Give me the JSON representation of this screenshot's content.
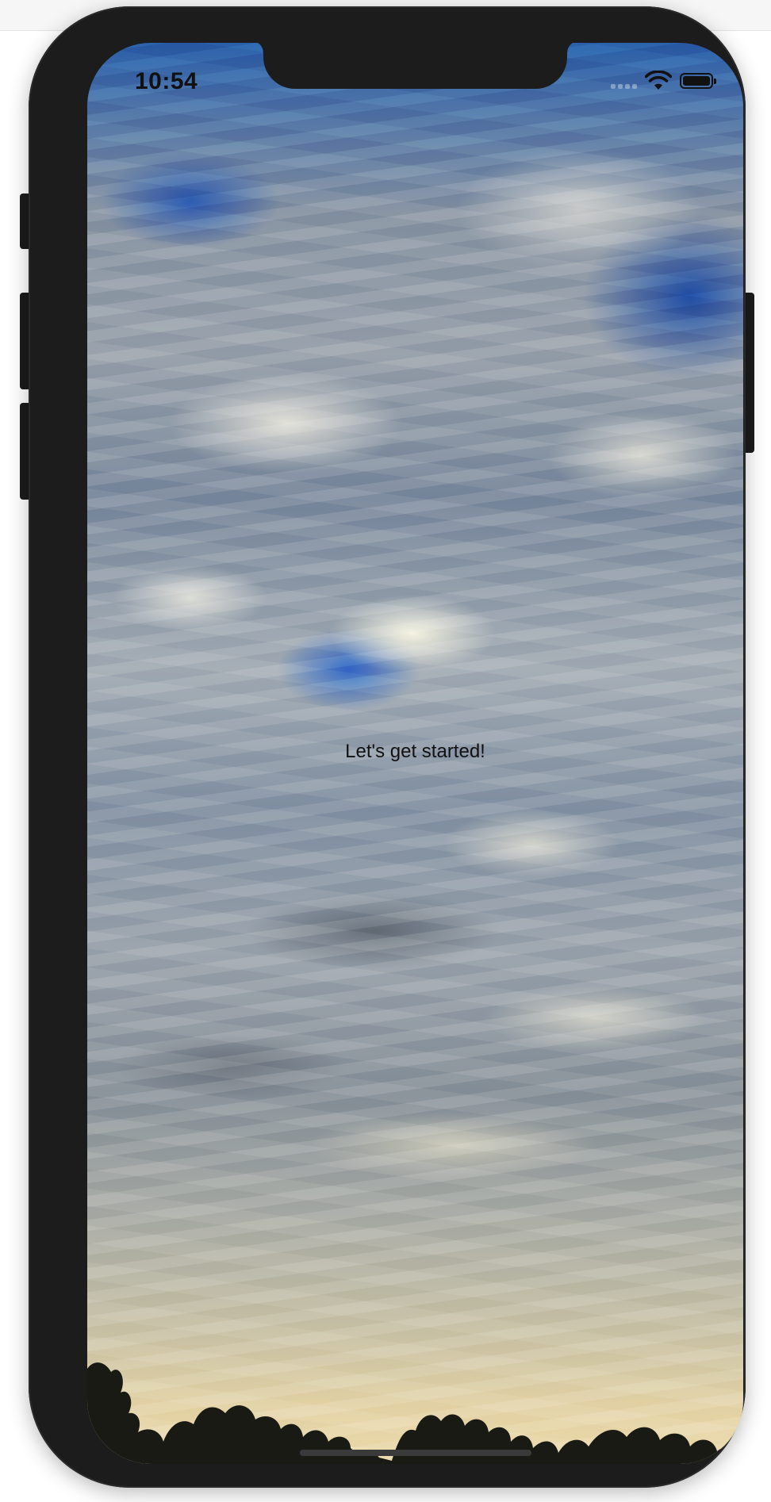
{
  "status_bar": {
    "time": "10:54",
    "signal_icon": "cellular-signal-icon",
    "wifi_icon": "wifi-icon",
    "battery_icon": "battery-icon",
    "battery_level_percent": 100
  },
  "main": {
    "welcome_text": "Let's get started!",
    "background_image": "cloudy-sky-at-dusk"
  },
  "colors": {
    "device_frame": "#1c1c1c",
    "text": "#111111",
    "sky_blue": "#2a5ea8"
  }
}
